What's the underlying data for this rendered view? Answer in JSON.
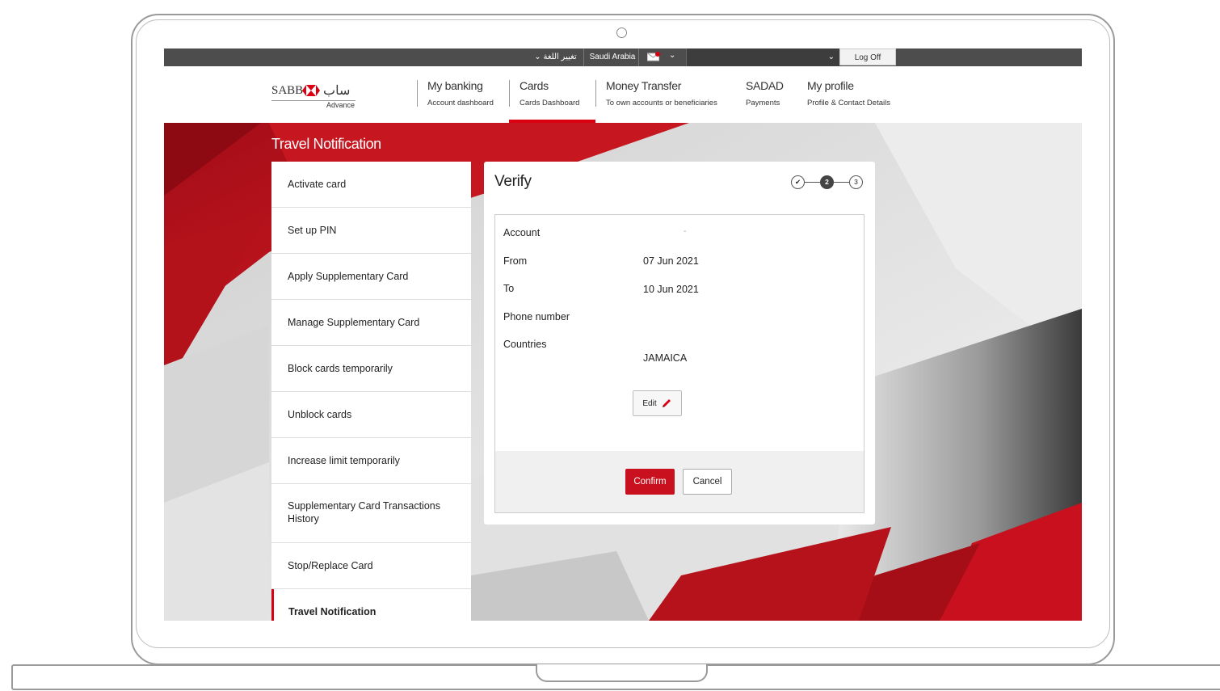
{
  "utility_bar": {
    "language_label": "تغيير اللغة",
    "country_label": "Saudi Arabia",
    "logoff_label": "Log Off"
  },
  "brand": {
    "name": "SABB",
    "arabic_name": "ساب",
    "tier": "Advance",
    "accent_color": "#db0011"
  },
  "nav": {
    "items": [
      {
        "title": "My banking",
        "sub": "Account dashboard"
      },
      {
        "title": "Cards",
        "sub": "Cards Dashboard"
      },
      {
        "title": "Money Transfer",
        "sub": "To own accounts or beneficiaries"
      },
      {
        "title": "SADAD",
        "sub": "Payments"
      },
      {
        "title": "My profile",
        "sub": "Profile & Contact Details"
      }
    ],
    "active_index": 1
  },
  "page": {
    "title": "Travel Notification"
  },
  "sidebar": {
    "items": [
      {
        "label": "Activate card"
      },
      {
        "label": "Set up PIN"
      },
      {
        "label": "Apply Supplementary Card"
      },
      {
        "label": "Manage Supplementary Card"
      },
      {
        "label": "Block cards temporarily"
      },
      {
        "label": "Unblock cards"
      },
      {
        "label": "Increase limit temporarily"
      },
      {
        "label": "Supplementary Card Transactions History"
      },
      {
        "label": "Stop/Replace Card"
      },
      {
        "label": "Travel Notification"
      }
    ],
    "active_index": 9
  },
  "verify": {
    "title": "Verify",
    "steps": [
      {
        "label": "✔",
        "state": "done"
      },
      {
        "label": "2",
        "state": "current"
      },
      {
        "label": "3",
        "state": "pending"
      }
    ],
    "fields": [
      {
        "label": "Account",
        "value": "-"
      },
      {
        "label": "From",
        "value": "07 Jun 2021"
      },
      {
        "label": "To",
        "value": "10 Jun 2021"
      },
      {
        "label": "Phone number",
        "value": ""
      },
      {
        "label": "Countries",
        "value": "JAMAICA"
      }
    ],
    "edit_label": "Edit",
    "confirm_label": "Confirm",
    "cancel_label": "Cancel"
  }
}
